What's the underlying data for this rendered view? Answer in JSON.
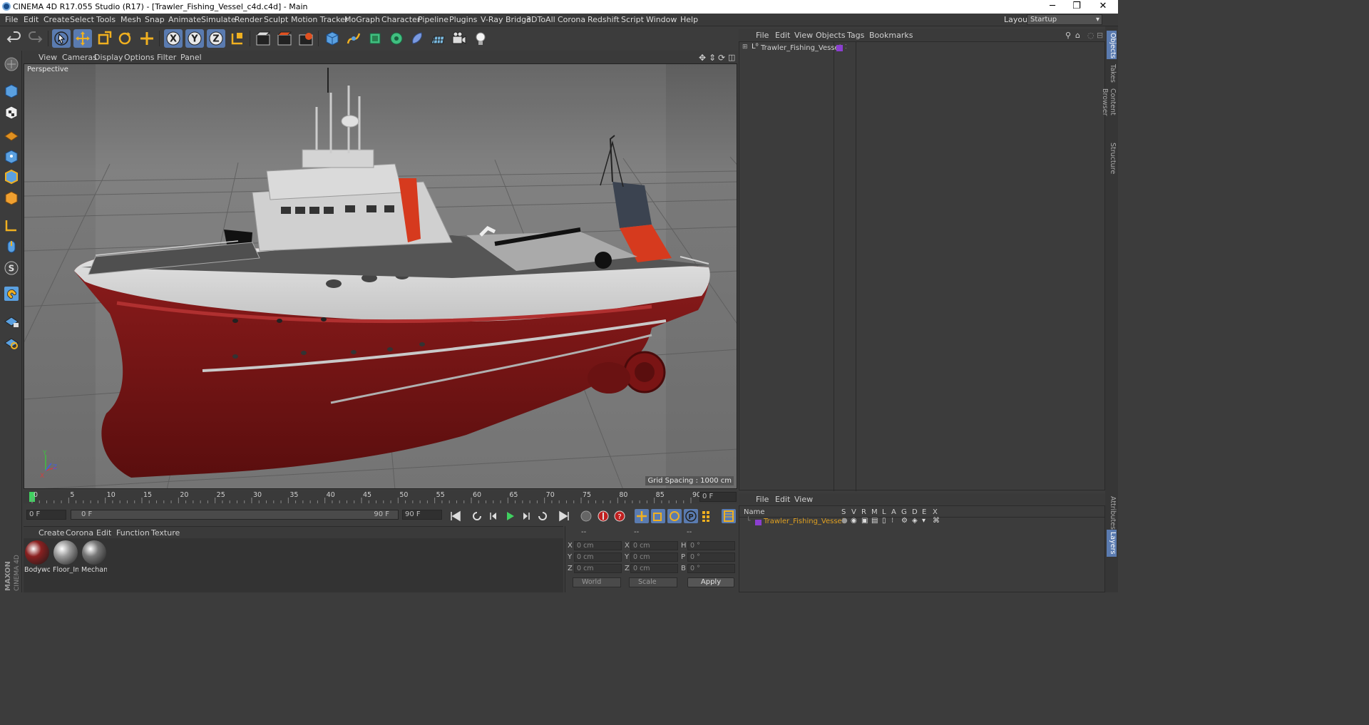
{
  "window": {
    "title": "CINEMA 4D R17.055 Studio (R17) - [Trawler_Fishing_Vessel_c4d.c4d] - Main",
    "controls": [
      "─",
      "❐",
      "✕"
    ]
  },
  "menubar": {
    "items": [
      "File",
      "Edit",
      "Create",
      "Select",
      "Tools",
      "Mesh",
      "Snap",
      "Animate",
      "Simulate",
      "Render",
      "Sculpt",
      "Motion Tracker",
      "MoGraph",
      "Character",
      "Pipeline",
      "Plugins",
      "V-Ray Bridge",
      "3DToAll",
      "Corona",
      "Redshift",
      "Script",
      "Window",
      "Help"
    ],
    "layout_label": "Layout:",
    "layout_value": "Startup"
  },
  "toolbar": {
    "icons": [
      "undo-icon",
      "redo-icon",
      "select-arrow-icon",
      "move-icon",
      "scale-icon",
      "rotate-icon",
      "add-icon",
      "x-axis-icon",
      "y-axis-icon",
      "z-axis-icon",
      "coordinate-system-icon",
      "render-view-icon",
      "render-picture-queue-icon",
      "render-settings-icon",
      "cube-primitive-icon",
      "spline-pen-icon",
      "subdivision-icon",
      "mograph-cloner-icon",
      "deformer-icon",
      "floor-grid-icon",
      "camera-icon",
      "light-icon"
    ]
  },
  "viewport": {
    "menu": [
      "View",
      "Cameras",
      "Display",
      "Options",
      "Filter",
      "Panel"
    ],
    "camera_label": "Perspective",
    "grid_spacing": "Grid Spacing : 1000 cm",
    "axis_labels": [
      "Y",
      "Z",
      "X"
    ],
    "colors": {
      "hull": "#8b1a1a",
      "hull_dark": "#5e0f0f",
      "superstructure": "#d8d8d8",
      "funnel": "#3b4350",
      "funnel_red": "#d63a1e",
      "grid_bg": "#6b6b6b"
    }
  },
  "timeline": {
    "ticks": [
      "0",
      "5",
      "10",
      "15",
      "20",
      "25",
      "30",
      "35",
      "40",
      "45",
      "50",
      "55",
      "60",
      "65",
      "70",
      "75",
      "80",
      "85",
      "90"
    ],
    "current_frame": "0 F",
    "start_field": "0 F",
    "range_start": "0 F",
    "range_end": "90 F",
    "end_field": "90 F"
  },
  "materials": {
    "menu": [
      "Create",
      "Corona",
      "Edit",
      "Function",
      "Texture"
    ],
    "items": [
      {
        "name": "Bodywo",
        "color": "#8a2020"
      },
      {
        "name": "Floor_In",
        "color": "#9a9a9a"
      },
      {
        "name": "Mechan",
        "color": "#777777"
      }
    ]
  },
  "coordinates": {
    "headers": [
      "--",
      "--",
      "--"
    ],
    "rows": [
      {
        "a": "X",
        "av": "0 cm",
        "b": "X",
        "bv": "0 cm",
        "c": "H",
        "cv": "0 °"
      },
      {
        "a": "Y",
        "av": "0 cm",
        "b": "Y",
        "bv": "0 cm",
        "c": "P",
        "cv": "0 °"
      },
      {
        "a": "Z",
        "av": "0 cm",
        "b": "Z",
        "bv": "0 cm",
        "c": "B",
        "cv": "0 °"
      }
    ],
    "mode1": "World",
    "mode2": "Scale",
    "apply": "Apply"
  },
  "object_manager": {
    "menu": [
      "File",
      "Edit",
      "View",
      "Objects",
      "Tags",
      "Bookmarks"
    ],
    "object_name": "Trawler_Fishing_Vessel",
    "object_color": "#8b3fd0"
  },
  "attribute_manager": {
    "menu": [
      "File",
      "Edit",
      "View"
    ],
    "columns": [
      "Name",
      "S",
      "V",
      "R",
      "M",
      "L",
      "A",
      "G",
      "D",
      "E",
      "X"
    ],
    "object_name": "Trawler_Fishing_Vessel",
    "object_name_color": "#e0a020"
  },
  "right_tabs": [
    "Objects",
    "Takes",
    "Content Browser",
    "Structure",
    "Attributes",
    "Layers"
  ],
  "brand": "MAXON CINEMA 4D"
}
